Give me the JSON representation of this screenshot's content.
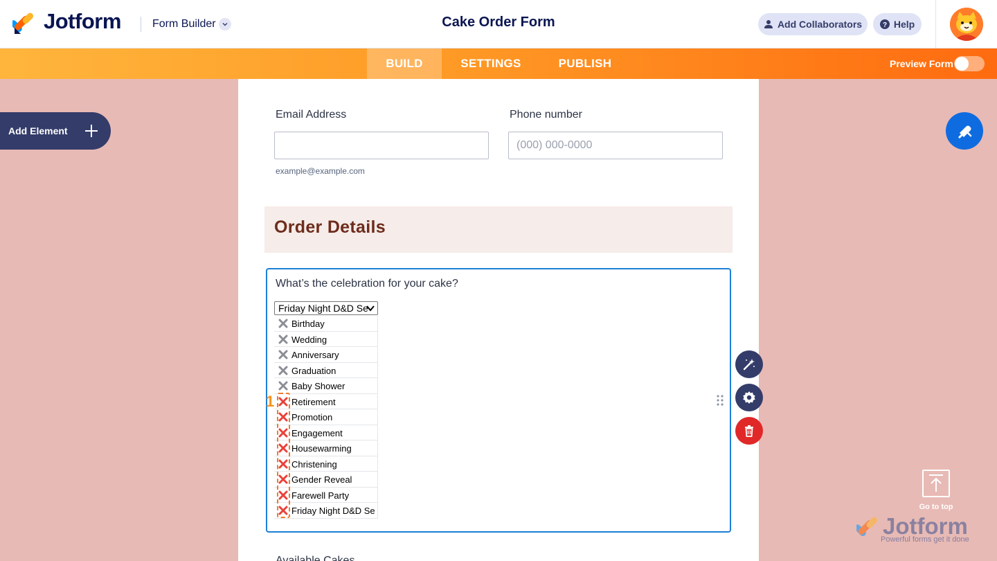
{
  "header": {
    "brand": "Jotform",
    "builder_label": "Form Builder",
    "form_title": "Cake Order Form",
    "add_collaborators": "Add Collaborators",
    "help": "Help"
  },
  "nav": {
    "tabs": [
      {
        "label": "BUILD",
        "active": true
      },
      {
        "label": "SETTINGS",
        "active": false
      },
      {
        "label": "PUBLISH",
        "active": false
      }
    ],
    "preview_label": "Preview Form",
    "preview_on": false
  },
  "sidebar": {
    "add_element": "Add Element"
  },
  "form": {
    "email": {
      "label": "Email Address",
      "value": "",
      "sublabel": "example@example.com"
    },
    "phone": {
      "label": "Phone number",
      "placeholder": "(000) 000-0000"
    },
    "section_title": "Order Details",
    "celebration": {
      "question": "What’s the celebration for your cake?",
      "selected": "Friday Night D&D Se",
      "options": [
        {
          "label": "Birthday",
          "x_color": "gray"
        },
        {
          "label": "Wedding",
          "x_color": "gray"
        },
        {
          "label": "Anniversary",
          "x_color": "gray"
        },
        {
          "label": "Graduation",
          "x_color": "gray"
        },
        {
          "label": "Baby Shower",
          "x_color": "gray"
        },
        {
          "label": "Retirement",
          "x_color": "red"
        },
        {
          "label": "Promotion",
          "x_color": "red"
        },
        {
          "label": "Engagement",
          "x_color": "red"
        },
        {
          "label": "Housewarming",
          "x_color": "red"
        },
        {
          "label": "Christening",
          "x_color": "red"
        },
        {
          "label": "Gender Reveal",
          "x_color": "red"
        },
        {
          "label": "Farewell Party",
          "x_color": "red"
        },
        {
          "label": "Friday Night D&D Se",
          "x_color": "red"
        }
      ],
      "annotation_marker": "1"
    },
    "next_field_label": "Available Cakes"
  },
  "footer": {
    "go_to_top": "Go to top",
    "watermark_brand": "Jotform",
    "watermark_tagline": "Powerful forms get it done"
  },
  "colors": {
    "accent_orange": "#ff6b10",
    "navy": "#0a1551",
    "canvas_bg": "#e8bab5",
    "selection_blue": "#1c7fd6",
    "delete_red": "#e02828",
    "section_title": "#6d2c1c"
  }
}
